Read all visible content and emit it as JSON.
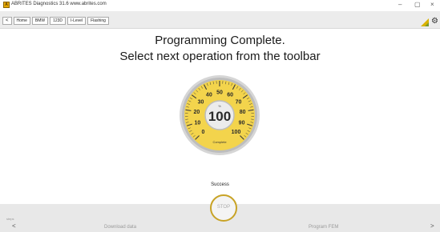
{
  "window": {
    "logo_letter": "A",
    "title": "ABRITES Diagnostics 31.6 www.abrites.com",
    "controls": {
      "minimize": "–",
      "maximize": "▢",
      "close": "×"
    }
  },
  "toolbar": {
    "back_glyph": "<",
    "breadcrumbs": [
      "Home",
      "BMW",
      "123D",
      "I-Level",
      "Flashing"
    ]
  },
  "headline": {
    "line1": "Programming Complete.",
    "line2": "Select next operation from the toolbar"
  },
  "gauge": {
    "value": 100,
    "min": 0,
    "max": 100,
    "unit": "%",
    "status": "Complete",
    "tick_labels": [
      "0",
      "10",
      "20",
      "30",
      "40",
      "50",
      "60",
      "70",
      "80",
      "90",
      "100"
    ],
    "accent": "#f3d44c"
  },
  "status_text": "Success",
  "bottom": {
    "steps_label": "steps",
    "stop_label": "STOP",
    "prev_step": "Download data",
    "next_step": "Program FEM",
    "nav_prev": "<",
    "nav_next": ">"
  },
  "colors": {
    "stop_ring": "#c8a326",
    "gauge_face": "#f3d44c",
    "toolbar_bg": "#ececec"
  }
}
